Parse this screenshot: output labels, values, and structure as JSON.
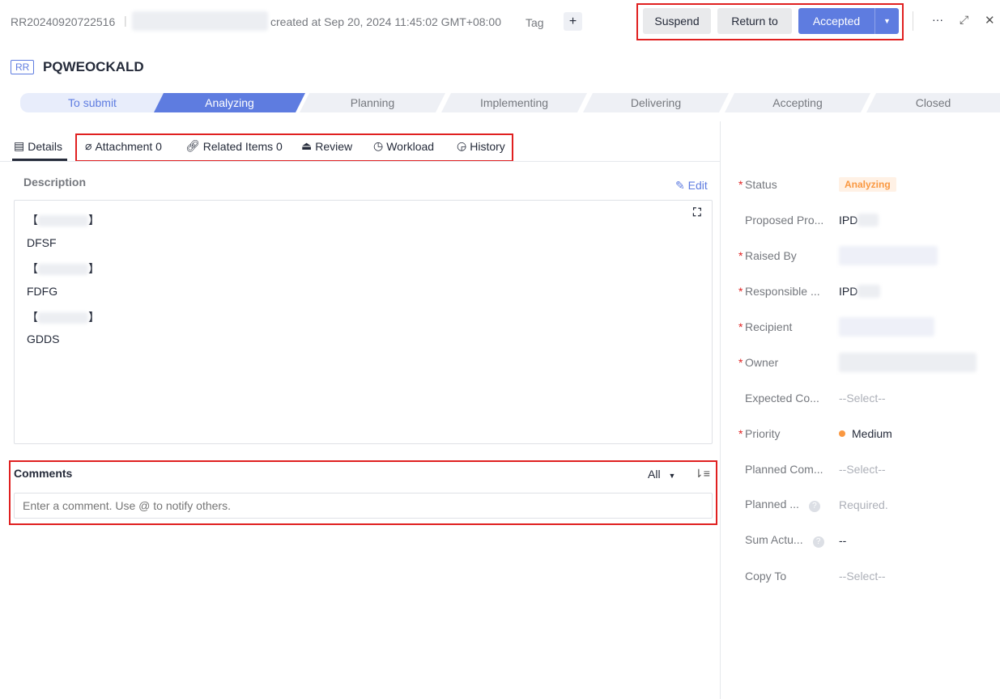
{
  "header": {
    "id": "RR20240920722516",
    "created": "created at Sep 20, 2024 11:45:02 GMT+08:00",
    "tag_label": "Tag",
    "add_tag": "+",
    "suspend": "Suspend",
    "return_to": "Return to",
    "accepted": "Accepted",
    "more": "···",
    "expand": "⤢",
    "close": "✕"
  },
  "title": {
    "badge": "RR",
    "text": "PQWEOCKALD"
  },
  "stages": [
    "To submit",
    "Analyzing",
    "Planning",
    "Implementing",
    "Delivering",
    "Accepting",
    "Closed"
  ],
  "tabs": {
    "details": "Details",
    "attachment": "Attachment 0",
    "related": "Related Items 0",
    "review": "Review",
    "workload": "Workload",
    "history": "History"
  },
  "description": {
    "title": "Description",
    "edit": "Edit",
    "lines": [
      "【",
      "】",
      "DFSF",
      "FDFG",
      "GDDS"
    ]
  },
  "comments": {
    "title": "Comments",
    "filter": "All",
    "placeholder": "Enter a comment. Use @ to notify others."
  },
  "fields": [
    {
      "label": "Status",
      "required": "*",
      "value": "Analyzing"
    },
    {
      "label": "Proposed Pro...",
      "value": "IPD"
    },
    {
      "label": "Raised By",
      "required": "*"
    },
    {
      "label": "Responsible ...",
      "required": "*",
      "value": "IPD"
    },
    {
      "label": "Recipient",
      "required": "*"
    },
    {
      "label": "Owner",
      "required": "*"
    },
    {
      "label": "Expected Co...",
      "value": "--Select--"
    },
    {
      "label": "Priority",
      "required": "*",
      "value": "Medium"
    },
    {
      "label": "Planned Com...",
      "value": "--Select--"
    },
    {
      "label": "Planned ...",
      "value": "Required."
    },
    {
      "label": "Sum Actu...",
      "value": "--"
    },
    {
      "label": "Copy To",
      "value": "--Select--"
    }
  ],
  "colors": {
    "accent": "#5e7ce0",
    "status": "#fa9841",
    "required": "#e02020"
  }
}
